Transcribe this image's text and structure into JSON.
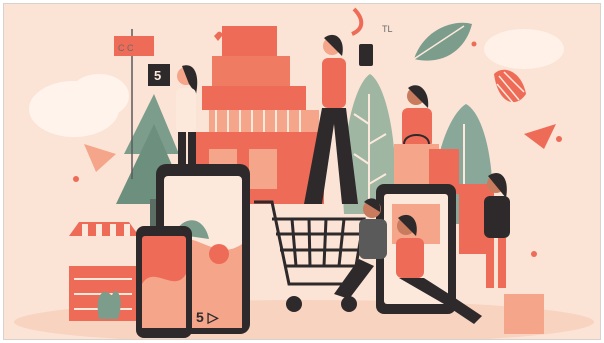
{
  "illustration": {
    "phone_screen_text": "5 ▷",
    "flag_card_text": "5",
    "sticker_text": "C C",
    "corner_scribble_text": "TL"
  },
  "colors": {
    "background": "#fbe4d6",
    "coral": "#ee6b57",
    "peach": "#f4a58a",
    "dark": "#2e2a2b",
    "teal": "#7c9c8c",
    "sage": "#9fb6a3",
    "cream": "#fde9dc"
  }
}
